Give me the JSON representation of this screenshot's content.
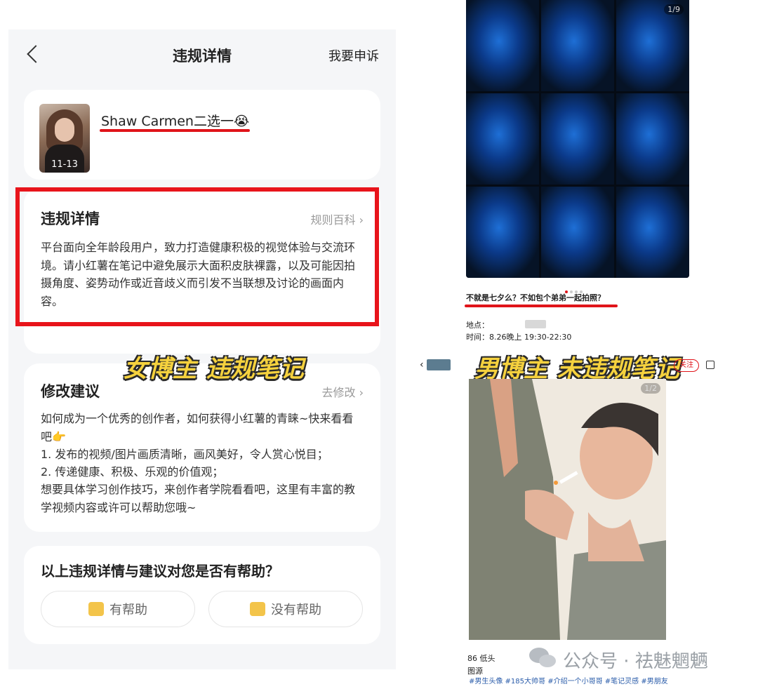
{
  "left": {
    "nav": {
      "title": "违规详情",
      "appeal": "我要申诉"
    },
    "note": {
      "username": "Shaw Carmen二选一😭",
      "thumb_date": "11-13"
    },
    "violation": {
      "title": "违规详情",
      "link": "规则百科 ›",
      "text": "平台面向全年龄段用户，致力打造健康积极的视觉体验与交流环境。请小红薯在笔记中避免展示大面积皮肤裸露，以及可能因拍摄角度、姿势动作或近音歧义而引发不当联想及讨论的画面内容。"
    },
    "overlay_caption": "女博主 违规笔记",
    "suggestion": {
      "title": "修改建议",
      "link": "去修改 ›",
      "lines": [
        "如何成为一个优秀的创作者，如何获得小红薯的青睐~快来看看吧👉",
        "1. 发布的视频/图片画质清晰，画风美好，令人赏心悦目；",
        "2. 传递健康、积极、乐观的价值观；",
        "想要具体学习创作技巧，来创作者学院看看吧，这里有丰富的教学视频内容或许可以帮助您哦~"
      ]
    },
    "feedback": {
      "question": "以上违规详情与建议对您是否有帮助？",
      "yes": "有帮助",
      "no": "没有帮助"
    }
  },
  "right": {
    "grid_counter": "1/9",
    "caption": "不就是七夕么？不如包个弟弟一起拍照？",
    "location_label": "地点：",
    "time": "时间：8.26晚上 19:30-22:30",
    "overlay_caption": "男博主 未违规笔记",
    "follow": "关注",
    "illus_counter": "1/2",
    "likes": "86 低头",
    "source_label": "图源",
    "watermark": "公众号 · 祛魅魍魉",
    "tags": "#男生头像 #185大帅哥 #介绍一个小哥哥 #笔记灵感 #男朋友"
  },
  "colors": {
    "red": "#e0141a",
    "caption_yellow": "#f6d23e"
  }
}
